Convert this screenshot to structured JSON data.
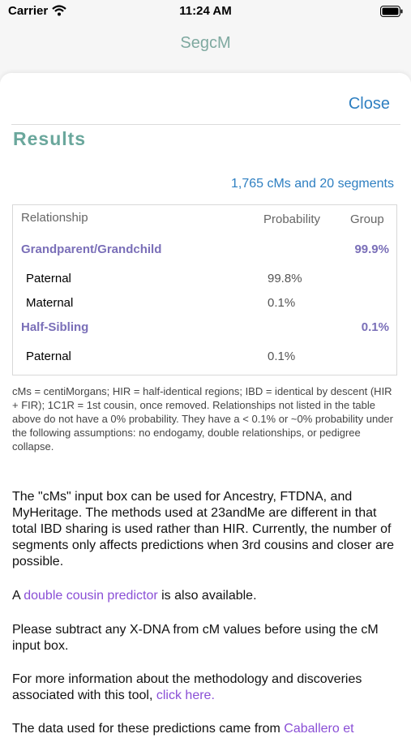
{
  "status_bar": {
    "carrier": "Carrier",
    "time": "11:24 AM"
  },
  "nav": {
    "title": "SegcM"
  },
  "sheet": {
    "close_label": "Close",
    "results_title": "Results",
    "summary": "1,765 cMs and 20 segments",
    "table": {
      "headers": {
        "relationship": "Relationship",
        "probability": "Probability",
        "group": "Group"
      },
      "groups": [
        {
          "name": "Grandparent/Grandchild",
          "group_value": "99.9%",
          "rows": [
            {
              "label": "Paternal",
              "probability": "99.8%"
            },
            {
              "label": "Maternal",
              "probability": "0.1%"
            }
          ]
        },
        {
          "name": "Half-Sibling",
          "group_value": "0.1%",
          "rows": [
            {
              "label": "Paternal",
              "probability": "0.1%"
            }
          ]
        }
      ]
    },
    "footnote": "cMs = centiMorgans; HIR = half-identical regions; IBD = identical by descent (HIR + FIR); 1C1R = 1st cousin, once removed. Relationships not listed in the table above do not have a 0% probability. They have a < 0.1% or ~0% probability under the following assumptions: no endogamy, double relationships, or pedigree collapse.",
    "para1": "The \"cMs\" input box can be used for Ancestry, FTDNA, and MyHeritage. The methods used at 23andMe are different in that total IBD sharing is used rather than HIR. Currently, the number of segments only affects predictions when 3rd cousins and closer are possible.",
    "para2": {
      "prefix": "A ",
      "link": "double cousin predictor",
      "suffix": " is also available."
    },
    "para3": "Please subtract any X-DNA from cM values before using the cM input box.",
    "para4": {
      "text": "For more information about the methodology and discoveries associated with this tool, ",
      "link": "click here."
    },
    "para5": {
      "text": "The data used for these predictions came from ",
      "link": "Caballero et"
    }
  },
  "colors": {
    "accent_teal": "#6aa79c",
    "link_blue": "#2e7fc1",
    "group_purple": "#7a6fb8",
    "link_purple": "#8a4fd6"
  }
}
